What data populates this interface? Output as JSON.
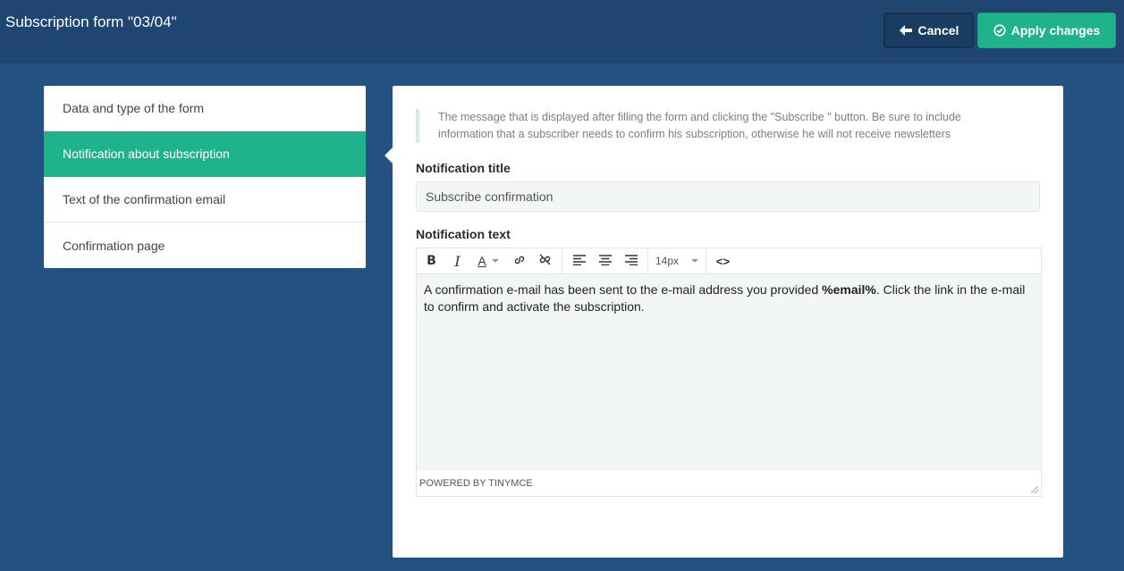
{
  "header": {
    "title": "Subscription form \"03/04\"",
    "cancel_label": "Cancel",
    "apply_label": "Apply changes"
  },
  "sidebar": {
    "items": [
      {
        "label": "Data and type of the form",
        "active": false
      },
      {
        "label": "Notification about subscription",
        "active": true
      },
      {
        "label": "Text of the confirmation email",
        "active": false
      },
      {
        "label": "Confirmation page",
        "active": false
      }
    ]
  },
  "panel": {
    "hint": "The message that is displayed after filling the form and clicking the \"Subscribe \" button. Be sure to include information that a subscriber needs to confirm his subscription, otherwise he will not receive newsletters",
    "title_label": "Notification title",
    "title_value": "Subscribe confirmation",
    "text_label": "Notification text",
    "editor": {
      "toolbar": {
        "bold": "B",
        "italic": "I",
        "font_color": "A",
        "font_size": "14px",
        "code": "<>"
      },
      "content_before": "A confirmation e-mail has been sent to the e-mail address you provided ",
      "content_bold": "%email%",
      "content_after": ". Click the link in the e-mail to confirm and activate the subscription.",
      "status": "POWERED BY TINYMCE"
    }
  },
  "colors": {
    "background": "#235181",
    "topbar": "#1f4670",
    "accent": "#1fb38b"
  }
}
